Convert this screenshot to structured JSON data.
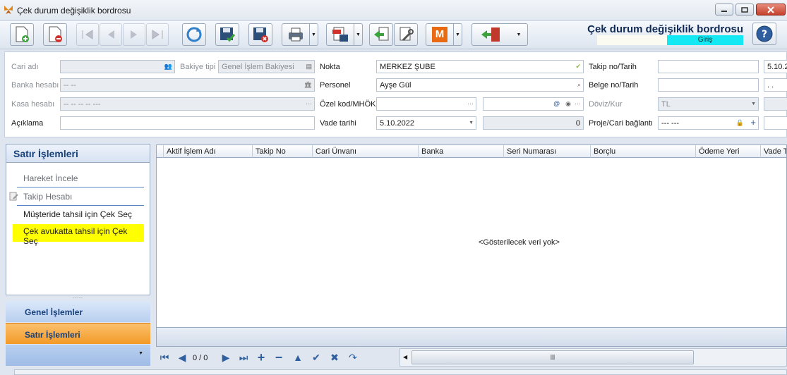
{
  "window": {
    "title": "Çek durum değişiklik bordrosu"
  },
  "header": {
    "title": "Çek durum değişiklik bordrosu",
    "mode": "Giriş"
  },
  "toolbar": {
    "buttons": [
      "new-icon",
      "delete-icon",
      "first-icon",
      "prev-icon",
      "next-icon",
      "last-icon",
      "refresh-icon",
      "save-icon",
      "save-cancel-icon",
      "print-icon",
      "pdf-icon",
      "import-icon",
      "tools-icon",
      "m-icon",
      "exit-icon",
      "help-icon"
    ],
    "m_label": "M"
  },
  "form": {
    "cari_adi": {
      "label": "Cari adı",
      "value": ""
    },
    "bakiye_tipi": {
      "label": "Bakiye tipi",
      "value": "Genel İşlem Bakiyesi"
    },
    "banka_hesabi": {
      "label": "Banka hesabı",
      "value": "-- --"
    },
    "kasa_hesabi": {
      "label": "Kasa hesabı",
      "value": "-- -- -- -- ---"
    },
    "aciklama": {
      "label": "Açıklama",
      "value": ""
    },
    "nokta": {
      "label": "Nokta",
      "value": "MERKEZ ŞUBE"
    },
    "personel": {
      "label": "Personel",
      "value": "Ayşe Gül"
    },
    "ozel_kod": {
      "label": "Özel kod/MHÖK",
      "value": ""
    },
    "vade_tarihi": {
      "label": "Vade tarihi",
      "value": "5.10.2022",
      "amount": "0"
    },
    "takip_no": {
      "label": "Takip no/Tarih",
      "value": "",
      "date": "5.10.2"
    },
    "belge_no": {
      "label": "Belge no/Tarih",
      "value": "",
      "date": ". ."
    },
    "doviz": {
      "label": "Döviz/Kur",
      "value": "TL"
    },
    "proje": {
      "label": "Proje/Cari bağlantı",
      "value": "--- ---"
    }
  },
  "left_panel": {
    "title": "Satır İşlemleri",
    "items": [
      {
        "label": "Hareket İncele",
        "enabled": false
      },
      {
        "label": "Takip Hesabı",
        "enabled": false
      },
      {
        "label": "Müşteride tahsil için Çek Seç",
        "enabled": true
      },
      {
        "label": "Çek avukatta tahsil için Çek Seç",
        "enabled": true,
        "highlighted": true
      }
    ],
    "grip": ".....",
    "nav": [
      "Genel İşlemler",
      "Satır İşlemleri"
    ]
  },
  "grid": {
    "columns": [
      "Aktif İşlem Adı",
      "Takip No",
      "Cari Ünvanı",
      "Banka",
      "Seri Numarası",
      "Borçlu",
      "Ödeme Yeri",
      "Vade T"
    ],
    "empty_text": "<Gösterilecek veri yok>"
  },
  "pager": {
    "page": "0 / 0"
  },
  "scroll": {
    "grip": "|||"
  },
  "colors": {
    "accent": "#17407a",
    "mode_bg": "#14e8f2",
    "highlight": "#ffff00",
    "nav_active": "#f8a33a"
  }
}
